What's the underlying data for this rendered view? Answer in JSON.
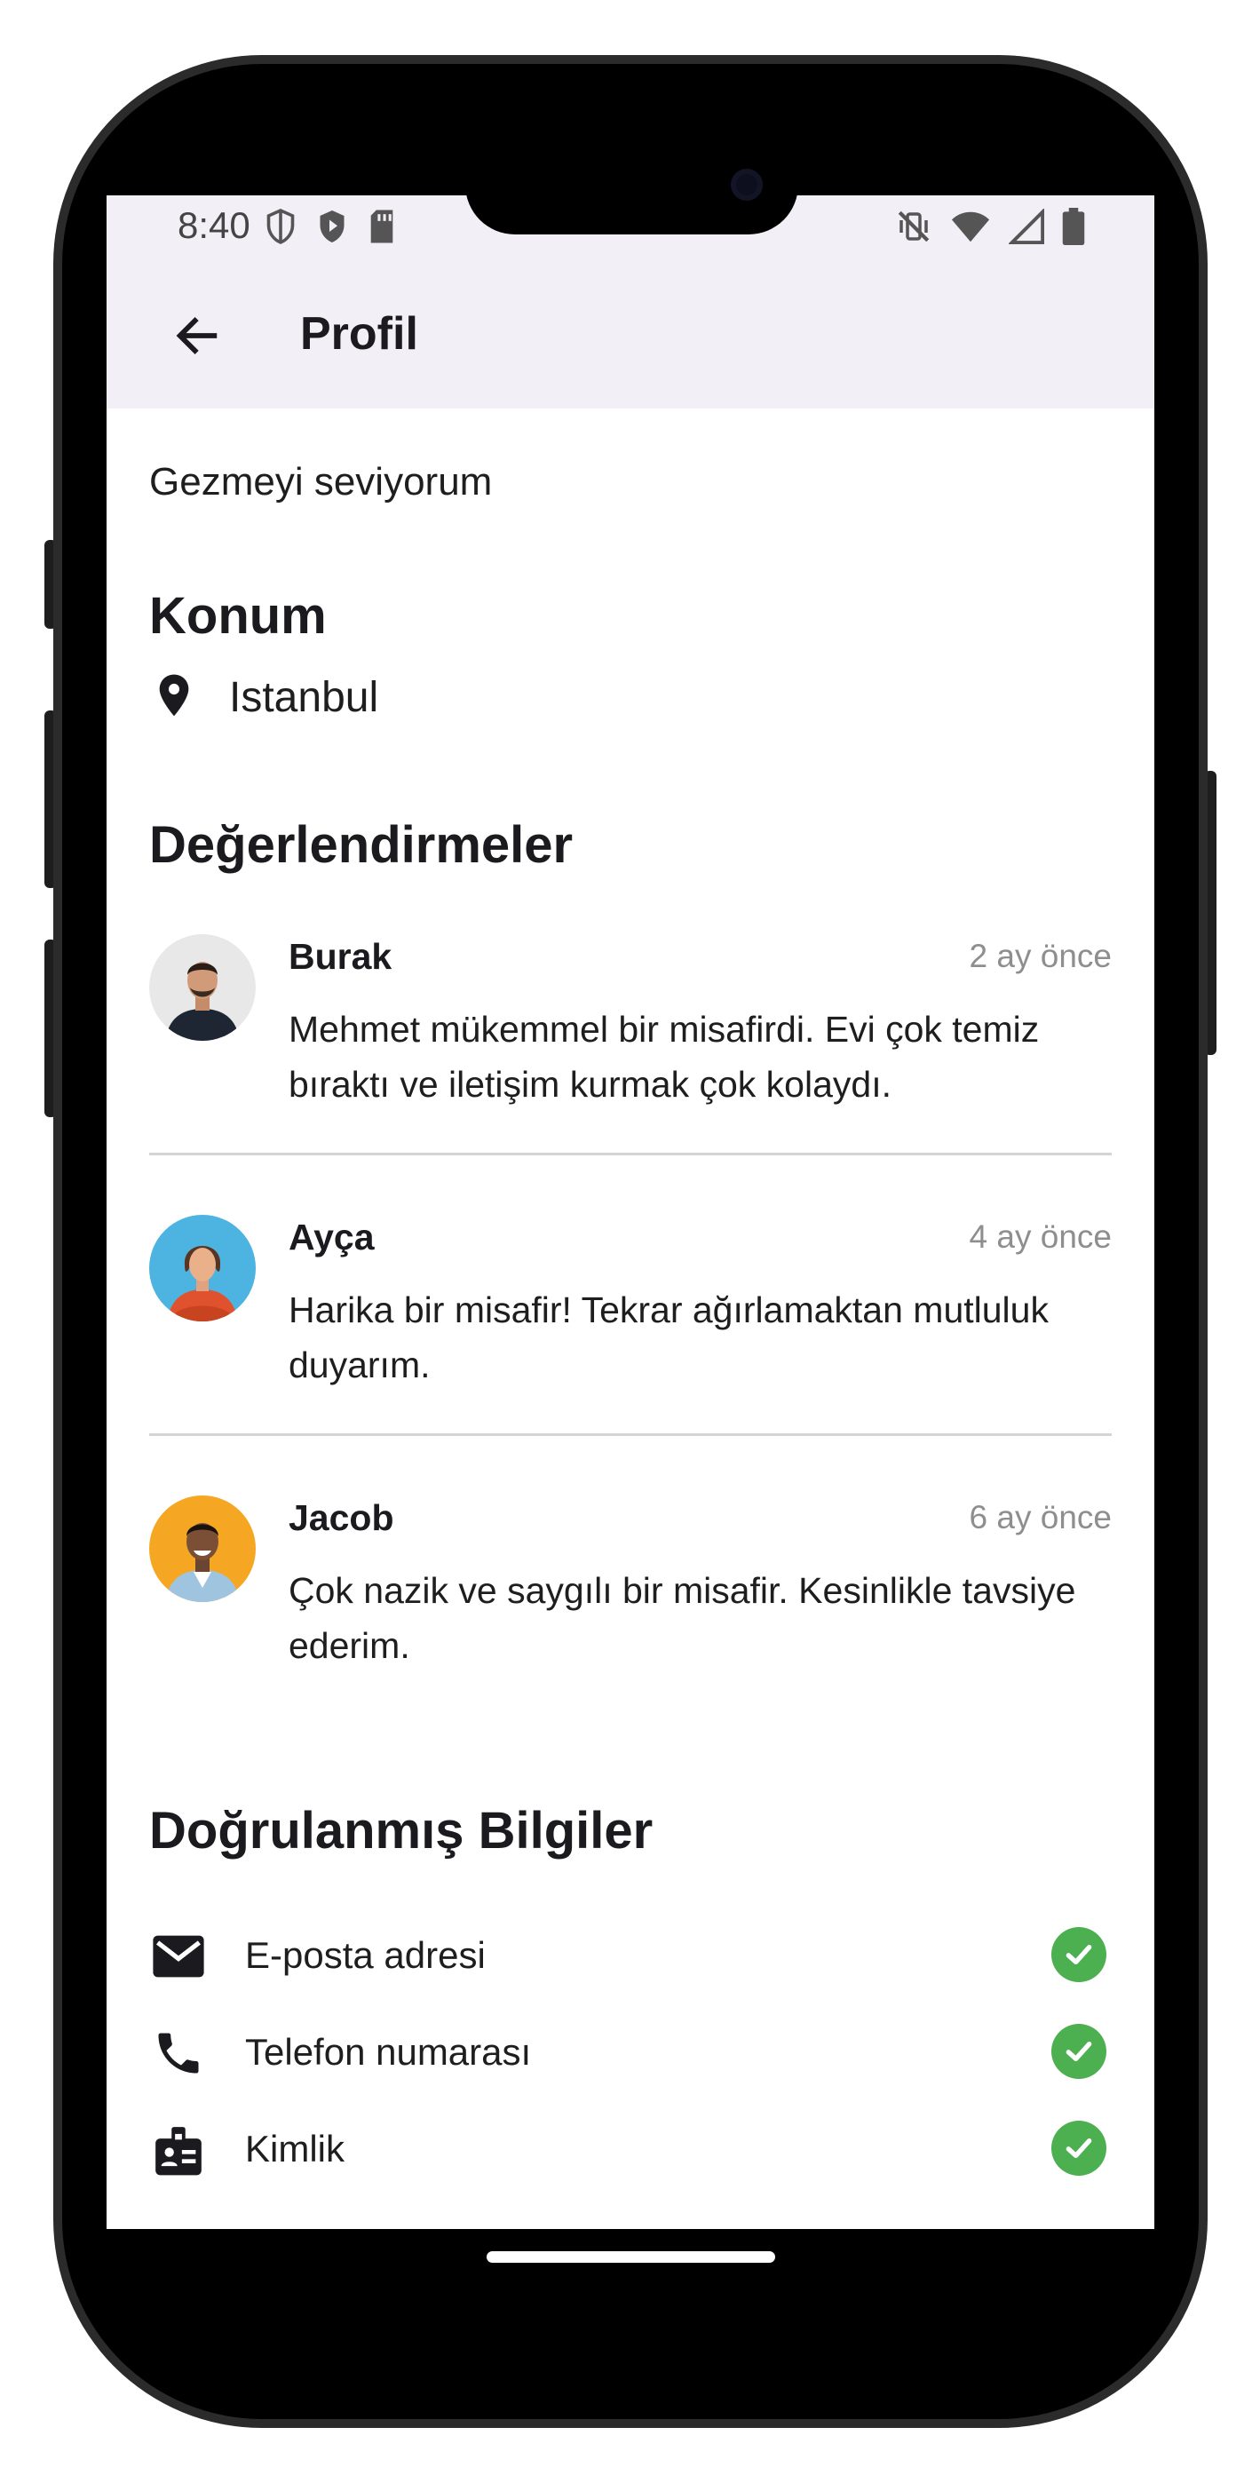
{
  "status_bar": {
    "time": "8:40",
    "left_icons": [
      "shield-outline-icon",
      "play-protect-icon",
      "sd-card-icon"
    ],
    "right_icons": [
      "vibrate-off-icon",
      "wifi-icon",
      "signal-icon",
      "battery-icon"
    ]
  },
  "app_bar": {
    "back_icon": "arrow-back-icon",
    "title": "Profil"
  },
  "bio": "Gezmeyi seviyorum",
  "location": {
    "section_title": "Konum",
    "icon": "location-pin-icon",
    "city": "Istanbul"
  },
  "reviews": {
    "section_title": "Değerlendirmeler",
    "items": [
      {
        "name": "Burak",
        "date": "2 ay önce",
        "text": "Mehmet mükemmel bir misafirdi. Evi çok temiz bıraktı ve iletişim kurmak çok kolaydı.",
        "avatar_bg": "#e8e8e8"
      },
      {
        "name": "Ayça",
        "date": "4 ay önce",
        "text": "Harika bir misafir! Tekrar ağırlamaktan mutluluk duyarım.",
        "avatar_bg": "#4db3e0"
      },
      {
        "name": "Jacob",
        "date": "6 ay önce",
        "text": "Çok nazik ve saygılı bir misafir. Kesinlikle tavsiye ederim.",
        "avatar_bg": "#f5a623"
      }
    ]
  },
  "verified": {
    "section_title": "Doğrulanmış Bilgiler",
    "items": [
      {
        "label": "E-posta adresi",
        "icon": "email-icon",
        "status_icon": "check-circle-icon"
      },
      {
        "label": "Telefon numarası",
        "icon": "phone-icon",
        "status_icon": "check-circle-icon"
      },
      {
        "label": "Kimlik",
        "icon": "id-badge-icon",
        "status_icon": "check-circle-icon"
      }
    ]
  },
  "colors": {
    "app_bar_bg": "#f3eff7",
    "verified_green": "#4caf50",
    "date_gray": "#8e8e8e"
  }
}
